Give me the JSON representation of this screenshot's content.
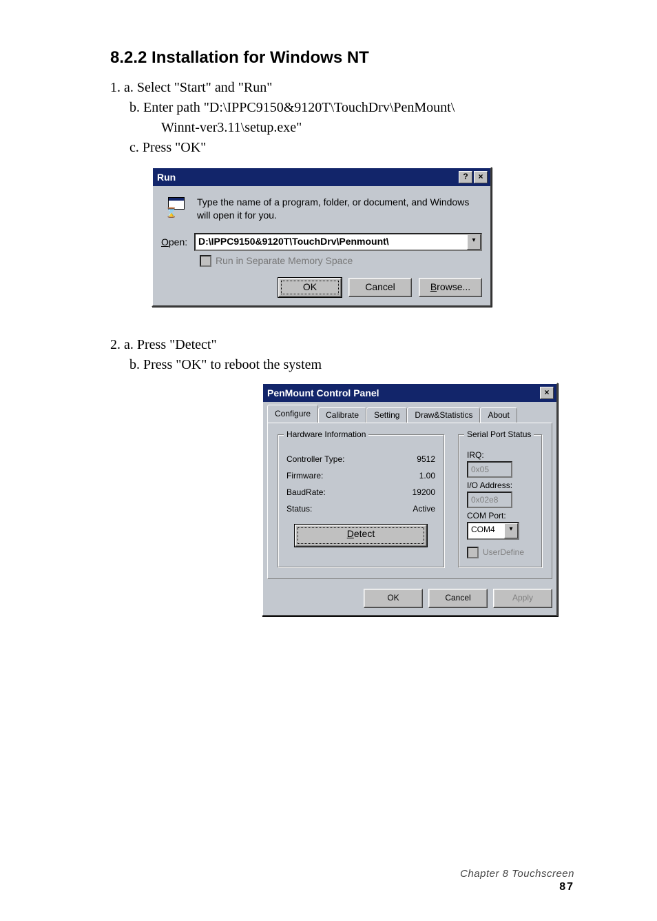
{
  "heading": "8.2.2 Installation for Windows NT",
  "step1": {
    "a": "1. a. Select \"Start\" and \"Run\"",
    "b1": "b. Enter path \"D:\\IPPC9150&9120T\\TouchDrv\\PenMount\\",
    "b2": "Winnt-ver3.11\\setup.exe\"",
    "c": "c. Press \"OK\""
  },
  "run": {
    "title": "Run",
    "help_glyph": "?",
    "close_glyph": "×",
    "desc": "Type the name of a program, folder, or document, and Windows will open it for you.",
    "open_label_u": "O",
    "open_label_rest": "pen:",
    "open_value": "D:\\IPPC9150&9120T\\TouchDrv\\Penmount\\",
    "dropdown_glyph": "▾",
    "sep_label_pre": "Run in Separate ",
    "sep_label_u": "M",
    "sep_label_post": "emory Space",
    "ok": "OK",
    "cancel": "Cancel",
    "browse_u": "B",
    "browse_rest": "rowse..."
  },
  "step2": {
    "a": "2. a. Press \"Detect\"",
    "b": "b. Press \"OK\" to reboot the system"
  },
  "penmount": {
    "title": "PenMount Control Panel",
    "close_glyph": "×",
    "tabs": [
      "Configure",
      "Calibrate",
      "Setting",
      "Draw&Statistics",
      "About"
    ],
    "hw": {
      "legend": "Hardware Information",
      "controller_type": "Controller Type:",
      "controller_type_v": "9512",
      "firmware": "Firmware:",
      "firmware_v": "1.00",
      "baudrate": "BaudRate:",
      "baudrate_v": "19200",
      "status": "Status:",
      "status_v": "Active",
      "detect_u": "D",
      "detect_rest": "etect"
    },
    "sp": {
      "legend": "Serial Port Status",
      "irq": "IRQ:",
      "irq_v": "0x05",
      "io": "I/O Address:",
      "io_v": "0x02e8",
      "com": "COM Port:",
      "com_v": "COM4",
      "dropdown_glyph": "▾",
      "userdefine": "UserDefine"
    },
    "ok": "OK",
    "cancel": "Cancel",
    "apply": "Apply"
  },
  "footer": {
    "chapter": "Chapter 8   Touchscreen",
    "page": "87"
  }
}
